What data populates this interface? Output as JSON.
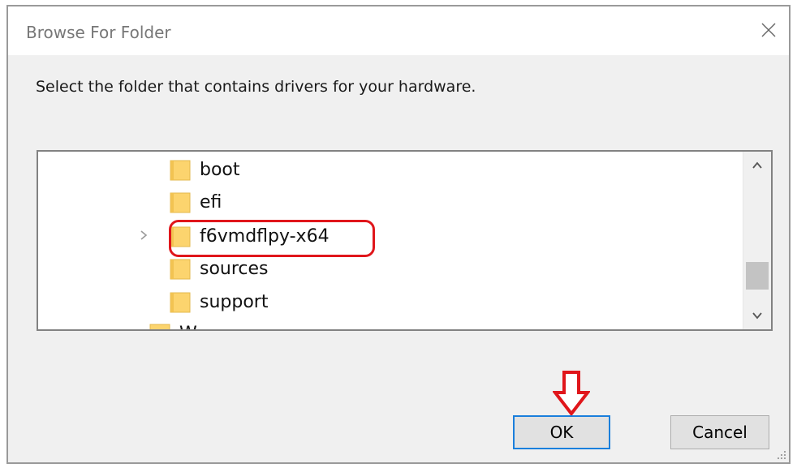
{
  "dialog": {
    "title": "Browse For Folder",
    "instruction": "Select the folder that contains drivers for your hardware."
  },
  "tree": {
    "items": [
      {
        "label": "boot",
        "icon": "folder-icon"
      },
      {
        "label": "efi",
        "icon": "folder-icon"
      },
      {
        "label": "f6vmdflpy-x64",
        "icon": "folder-icon",
        "expandable": true,
        "highlighted": true
      },
      {
        "label": "sources",
        "icon": "folder-icon"
      },
      {
        "label": "support",
        "icon": "folder-icon"
      },
      {
        "label": "W",
        "icon": "folder-icon",
        "partial": true
      }
    ]
  },
  "buttons": {
    "ok": "OK",
    "cancel": "Cancel"
  },
  "colors": {
    "highlight": "#e0161b",
    "folder": "#fcd46e",
    "ok_border": "#1a7fdc"
  }
}
